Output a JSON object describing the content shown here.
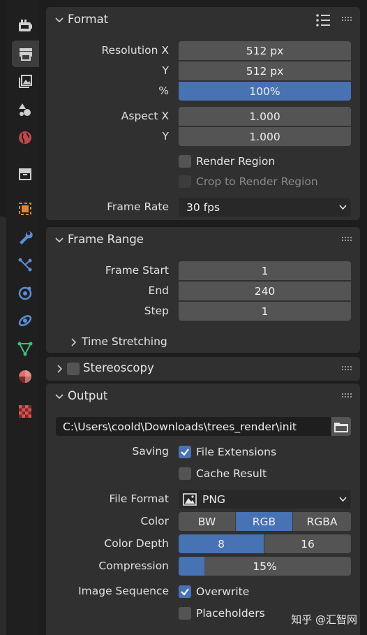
{
  "format": {
    "title": "Format",
    "resolution_x_label": "Resolution X",
    "resolution_x": "512 px",
    "resolution_y_label": "Y",
    "resolution_y": "512 px",
    "percent_label": "%",
    "percent": "100%",
    "aspect_x_label": "Aspect X",
    "aspect_x": "1.000",
    "aspect_y_label": "Y",
    "aspect_y": "1.000",
    "render_region": "Render Region",
    "crop_region": "Crop to Render Region",
    "frame_rate_label": "Frame Rate",
    "frame_rate": "30 fps"
  },
  "frame_range": {
    "title": "Frame Range",
    "start_label": "Frame Start",
    "start": "1",
    "end_label": "End",
    "end": "240",
    "step_label": "Step",
    "step": "1",
    "time_stretching": "Time Stretching"
  },
  "stereoscopy": {
    "title": "Stereoscopy"
  },
  "output": {
    "title": "Output",
    "path": "C:\\Users\\coold\\Downloads\\trees_render\\init",
    "saving_label": "Saving",
    "file_extensions": "File Extensions",
    "cache_result": "Cache Result",
    "file_format_label": "File Format",
    "file_format": "PNG",
    "color_label": "Color",
    "color_options": [
      "BW",
      "RGB",
      "RGBA"
    ],
    "color_depth_label": "Color Depth",
    "depth_options": [
      "8",
      "16"
    ],
    "compression_label": "Compression",
    "compression": "15%",
    "compression_fraction": 0.15,
    "image_sequence_label": "Image Sequence",
    "overwrite": "Overwrite",
    "placeholders": "Placeholders"
  },
  "watermark": "知乎 @汇智网",
  "colors": {
    "accent": "#4772b3",
    "panel": "#303030",
    "field": "#545454"
  },
  "icons": [
    "render-tool-icon",
    "output-printer-icon",
    "view-layer-icon",
    "scene-icon",
    "world-icon",
    "collection-icon",
    "object-icon",
    "modifier-wrench-icon",
    "particles-icon",
    "physics-icon",
    "constraints-icon",
    "object-data-icon",
    "material-icon",
    "texture-icon"
  ]
}
